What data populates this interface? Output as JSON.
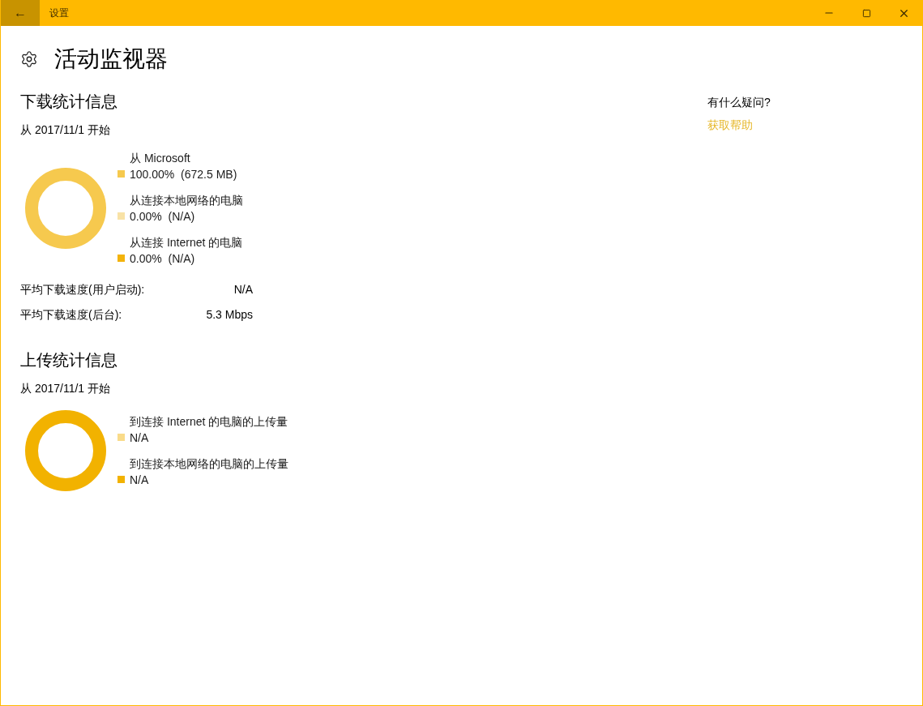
{
  "window": {
    "title": "设置",
    "back": "←"
  },
  "page": {
    "title": "活动监视器"
  },
  "download": {
    "heading": "下载统计信息",
    "since": "从 2017/11/1 开始",
    "legend": [
      {
        "label": "从 Microsoft",
        "value": "100.00%  (672.5 MB)",
        "color": "#f6c94e"
      },
      {
        "label": "从连接本地网络的电脑",
        "value": "0.00%  (N/A)",
        "color": "#f8e2a6"
      },
      {
        "label": "从连接 Internet 的电脑",
        "value": "0.00%  (N/A)",
        "color": "#f3b30c"
      }
    ],
    "stats": [
      {
        "label": "平均下载速度(用户启动):",
        "value": "N/A"
      },
      {
        "label": "平均下载速度(后台):",
        "value": "5.3 Mbps"
      }
    ]
  },
  "upload": {
    "heading": "上传统计信息",
    "since": "从 2017/11/1 开始",
    "legend": [
      {
        "label": "到连接 Internet 的电脑的上传量",
        "value": "N/A",
        "color": "#f9db8a"
      },
      {
        "label": "到连接本地网络的电脑的上传量",
        "value": "N/A",
        "color": "#f2b200"
      }
    ]
  },
  "help": {
    "question": "有什么疑问?",
    "link": "获取帮助"
  }
}
